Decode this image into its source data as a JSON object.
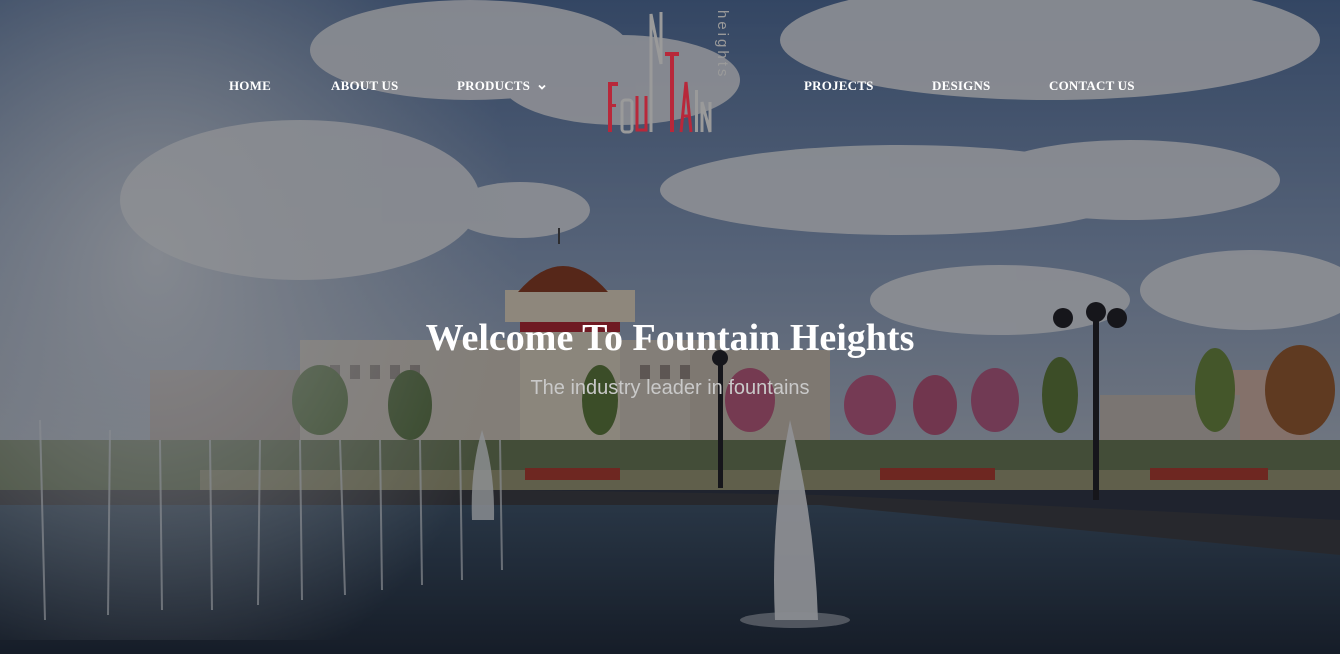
{
  "nav": {
    "left": [
      {
        "label": "HOME"
      },
      {
        "label": "ABOUT US"
      },
      {
        "label": "PRODUCTS"
      }
    ],
    "right": [
      {
        "label": "PROJECTS"
      },
      {
        "label": "DESIGNS"
      },
      {
        "label": "CONTACT US"
      }
    ],
    "products_dropdown_icon": "chevron-down-icon"
  },
  "logo": {
    "brand": "FOUNTAIN",
    "tagline": "heights",
    "colors": {
      "red": "#b8283a",
      "gray": "#9a9a9a"
    }
  },
  "hero": {
    "title": "Welcome To Fountain Heights",
    "subtitle": "The industry leader in fountains"
  }
}
